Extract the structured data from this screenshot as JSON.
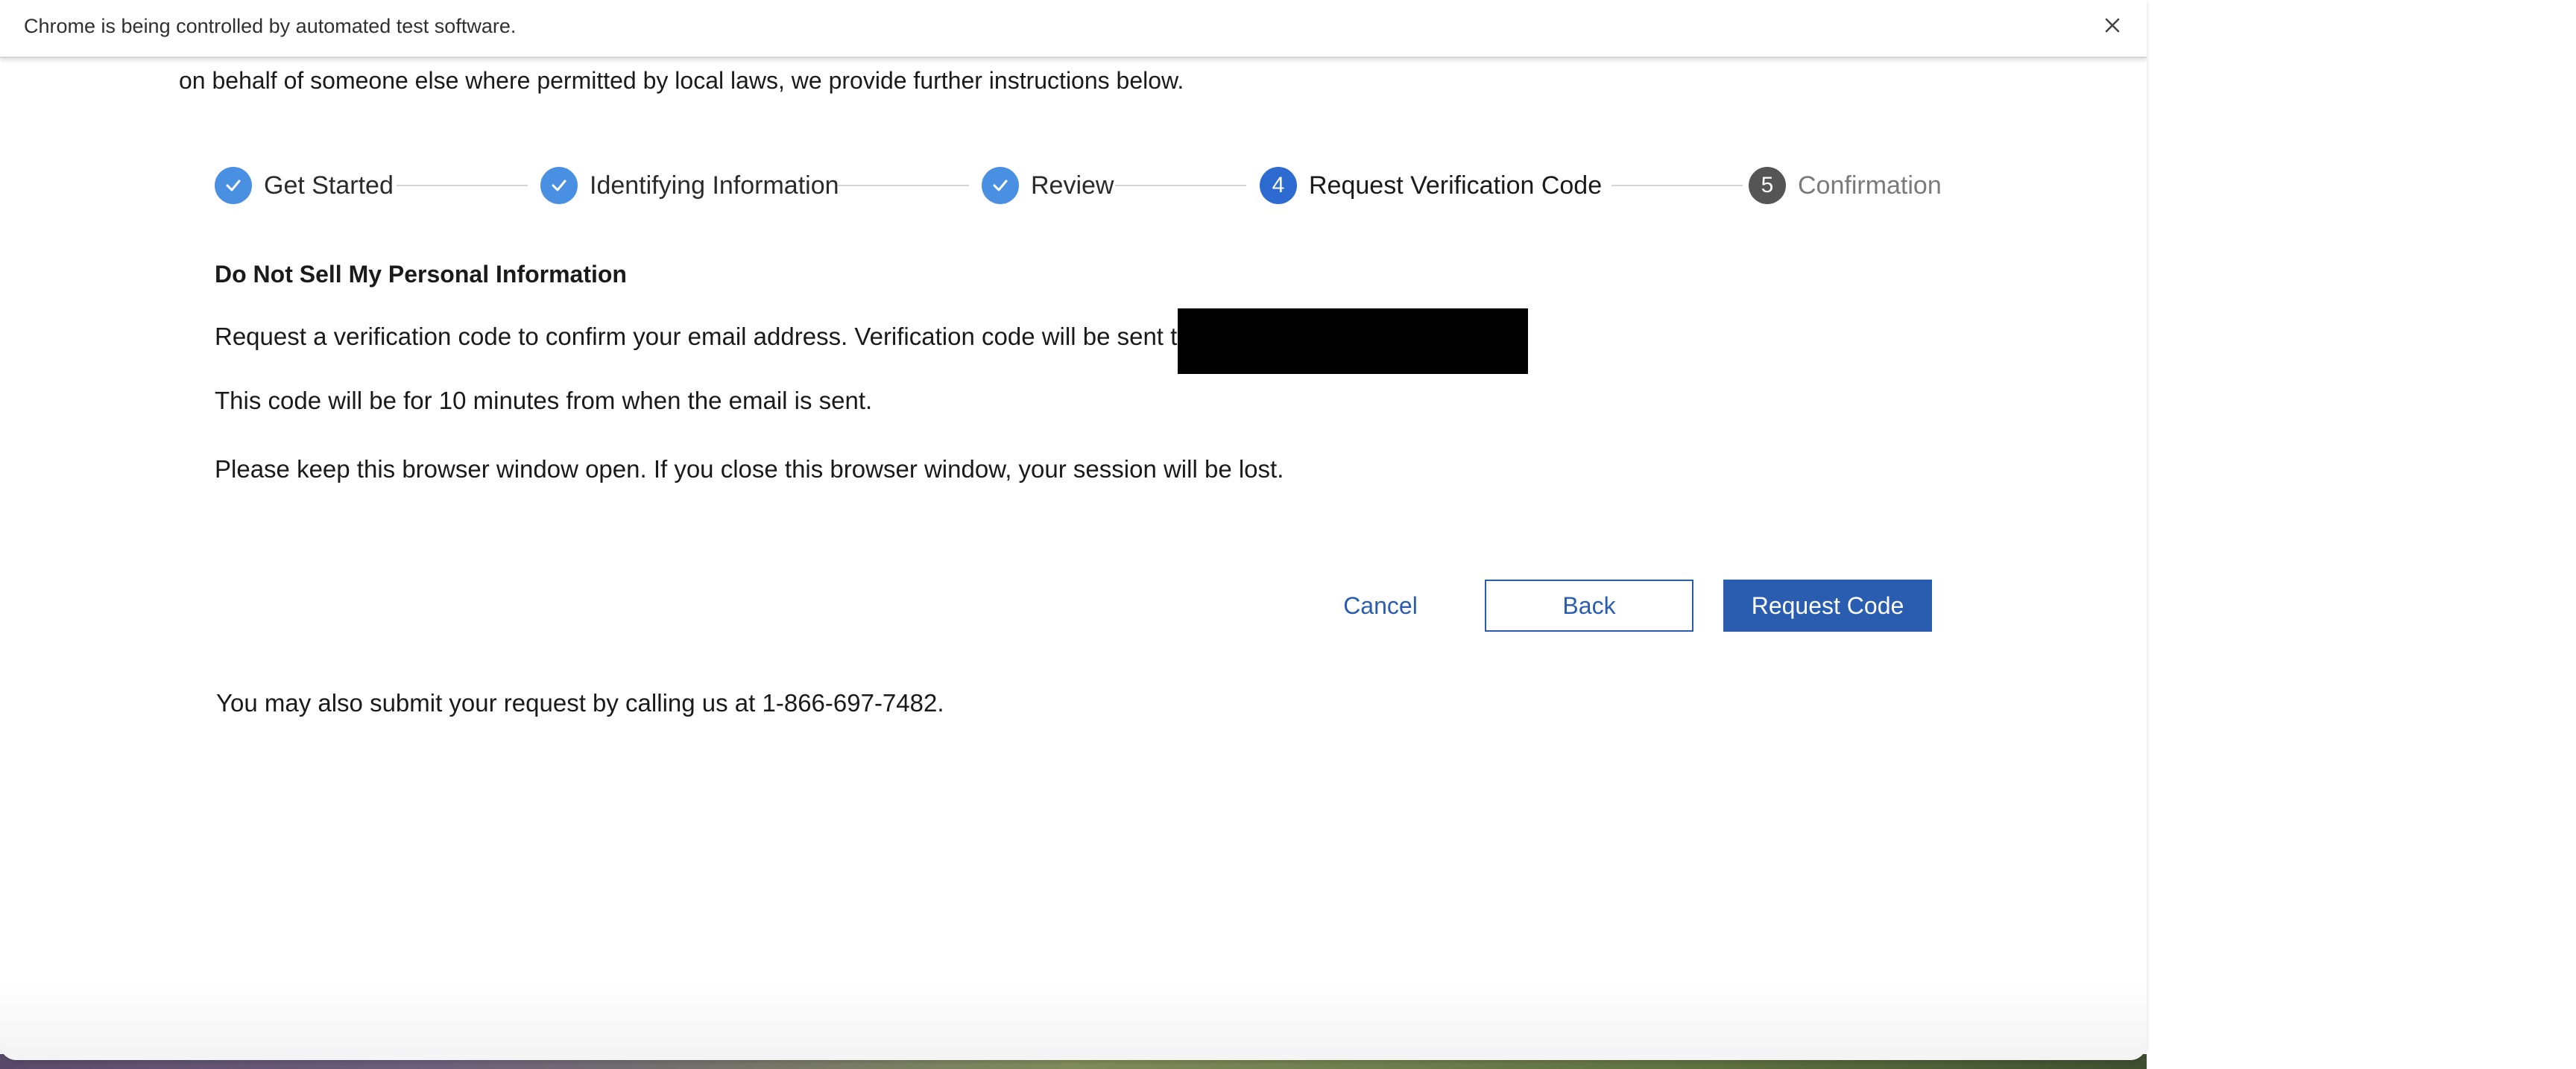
{
  "infobar": {
    "message": "Chrome is being controlled by automated test software.",
    "close_icon": "close-icon"
  },
  "page": {
    "intro": "on behalf of someone else where permitted by local laws, we provide further instructions below.",
    "stepper": {
      "steps": [
        {
          "label": "Get Started",
          "state": "done",
          "number": ""
        },
        {
          "label": "Identifying Information",
          "state": "done",
          "number": ""
        },
        {
          "label": "Review",
          "state": "done",
          "number": ""
        },
        {
          "label": "Request Verification Code",
          "state": "active",
          "number": "4"
        },
        {
          "label": "Confirmation",
          "state": "upcoming",
          "number": "5"
        }
      ]
    },
    "section_title": "Do Not Sell My Personal Information",
    "verification_text": "Request a verification code to confirm your email address. Verification code will be sent to",
    "code_validity": "This code will be for 10 minutes from when the email is sent.",
    "keep_open_notice": "Please keep this browser window open. If you close this browser window, your session will be lost.",
    "buttons": {
      "cancel": "Cancel",
      "back": "Back",
      "request_code": "Request Code"
    },
    "phone_notice": "You may also submit your request by calling us at 1-866-697-7482."
  },
  "colors": {
    "accent": "#2a5db0",
    "step_done": "#4a90e2",
    "step_active": "#2d6bd0",
    "step_upcoming": "#555555"
  }
}
